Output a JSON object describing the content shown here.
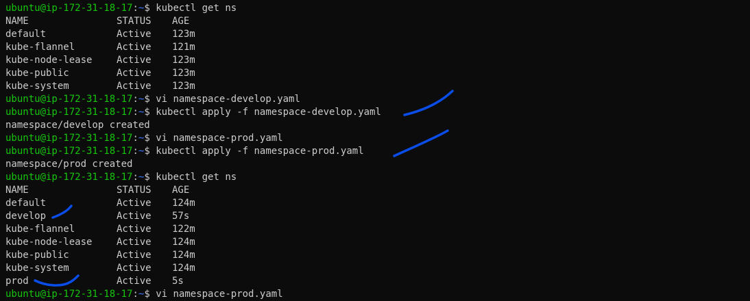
{
  "terminal": {
    "prompt_user_host": "ubuntu@ip-172-31-18-17",
    "prompt_sep": ":",
    "prompt_path": "~",
    "prompt_symbol": "$",
    "lines": [
      {
        "type": "cmd",
        "text": "kubectl get ns"
      },
      {
        "type": "row",
        "cols": [
          "NAME",
          "STATUS",
          "AGE"
        ]
      },
      {
        "type": "row",
        "cols": [
          "default",
          "Active",
          "123m"
        ]
      },
      {
        "type": "row",
        "cols": [
          "kube-flannel",
          "Active",
          "121m"
        ]
      },
      {
        "type": "row",
        "cols": [
          "kube-node-lease",
          "Active",
          "123m"
        ]
      },
      {
        "type": "row",
        "cols": [
          "kube-public",
          "Active",
          "123m"
        ]
      },
      {
        "type": "row",
        "cols": [
          "kube-system",
          "Active",
          "123m"
        ]
      },
      {
        "type": "cmd",
        "text": "vi namespace-develop.yaml"
      },
      {
        "type": "cmd",
        "text": "kubectl apply -f namespace-develop.yaml"
      },
      {
        "type": "out",
        "text": "namespace/develop created"
      },
      {
        "type": "cmd",
        "text": "vi namespace-prod.yaml"
      },
      {
        "type": "cmd",
        "text": "kubectl apply -f namespace-prod.yaml"
      },
      {
        "type": "out",
        "text": "namespace/prod created"
      },
      {
        "type": "cmd",
        "text": "kubectl get ns"
      },
      {
        "type": "row",
        "cols": [
          "NAME",
          "STATUS",
          "AGE"
        ]
      },
      {
        "type": "row",
        "cols": [
          "default",
          "Active",
          "124m"
        ]
      },
      {
        "type": "row",
        "cols": [
          "develop",
          "Active",
          "57s"
        ]
      },
      {
        "type": "row",
        "cols": [
          "kube-flannel",
          "Active",
          "122m"
        ]
      },
      {
        "type": "row",
        "cols": [
          "kube-node-lease",
          "Active",
          "124m"
        ]
      },
      {
        "type": "row",
        "cols": [
          "kube-public",
          "Active",
          "124m"
        ]
      },
      {
        "type": "row",
        "cols": [
          "kube-system",
          "Active",
          "124m"
        ]
      },
      {
        "type": "row",
        "cols": [
          "prod",
          "Active",
          "5s"
        ]
      },
      {
        "type": "cmd",
        "text": "vi namespace-prod.yaml"
      }
    ]
  },
  "colors": {
    "background": "#0c0c0c",
    "text": "#cccccc",
    "prompt": "#16c60c",
    "path": "#3b78ff",
    "annotation": "#0a4de8"
  }
}
